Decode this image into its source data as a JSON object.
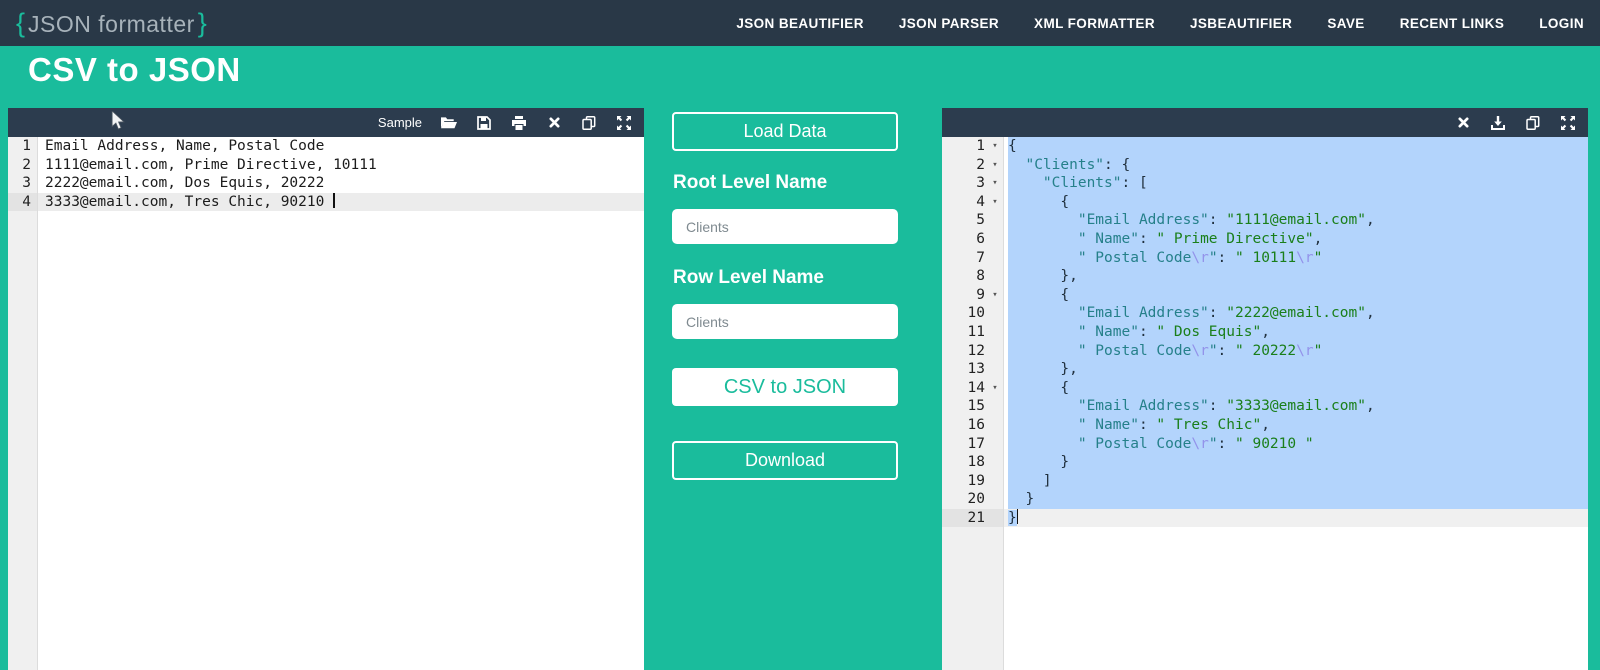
{
  "navbar": {
    "logo": {
      "open_brace": "{",
      "text": "JSON formatter",
      "close_brace": "}"
    },
    "items": [
      "JSON BEAUTIFIER",
      "JSON PARSER",
      "XML FORMATTER",
      "JSBEAUTIFIER",
      "SAVE",
      "RECENT LINKS",
      "LOGIN"
    ]
  },
  "page": {
    "title": "CSV to JSON"
  },
  "colors": {
    "teal_accent": "#1abc9c",
    "navbar_bg": "#293847",
    "toolbar_bg": "#2c3c4e",
    "selection_blue": "#b3d4fc",
    "json_key": "#25808a",
    "json_string": "#1a7f1a",
    "json_escape": "#9393ea"
  },
  "left_editor": {
    "toolbar": {
      "sample_label": "Sample",
      "icons": [
        "folder-open-icon",
        "save-icon",
        "print-icon",
        "clear-icon",
        "copy-icon",
        "fullscreen-icon"
      ]
    },
    "active_line": 4,
    "lines": [
      "Email Address, Name, Postal Code",
      "1111@email.com, Prime Directive, 10111",
      "2222@email.com, Dos Equis, 20222",
      "3333@email.com, Tres Chic, 90210 "
    ]
  },
  "controls": {
    "load_data_label": "Load Data",
    "root_level_label": "Root Level Name",
    "root_level_value": "Clients",
    "row_level_label": "Row Level Name",
    "row_level_value": "Clients",
    "convert_label": "CSV to JSON",
    "download_label": "Download"
  },
  "right_editor": {
    "toolbar": {
      "icons": [
        "clear-icon",
        "download-icon",
        "copy-icon",
        "fullscreen-icon"
      ]
    },
    "active_line": 21,
    "selected_from": 1,
    "selected_to": 20,
    "tail_selected": true,
    "fold_lines": [
      1,
      2,
      3,
      4,
      9,
      14
    ],
    "lines": [
      [
        [
          "{",
          "pln"
        ]
      ],
      [
        [
          "  ",
          "pln"
        ],
        [
          "\"Clients\"",
          "key"
        ],
        [
          ": {",
          "pln"
        ]
      ],
      [
        [
          "    ",
          "pln"
        ],
        [
          "\"Clients\"",
          "key"
        ],
        [
          ": [",
          "pln"
        ]
      ],
      [
        [
          "      {",
          "pln"
        ]
      ],
      [
        [
          "        ",
          "pln"
        ],
        [
          "\"Email Address\"",
          "key"
        ],
        [
          ": ",
          "pln"
        ],
        [
          "\"1111@email.com\"",
          "str"
        ],
        [
          ",",
          "pln"
        ]
      ],
      [
        [
          "        ",
          "pln"
        ],
        [
          "\" Name\"",
          "key"
        ],
        [
          ": ",
          "pln"
        ],
        [
          "\" Prime Directive\"",
          "str"
        ],
        [
          ",",
          "pln"
        ]
      ],
      [
        [
          "        ",
          "pln"
        ],
        [
          "\" Postal Code",
          "key"
        ],
        [
          "\\r",
          "esc"
        ],
        [
          "\"",
          "key"
        ],
        [
          ": ",
          "pln"
        ],
        [
          "\" 10111",
          "str"
        ],
        [
          "\\r",
          "esc"
        ],
        [
          "\"",
          "str"
        ]
      ],
      [
        [
          "      },",
          "pln"
        ]
      ],
      [
        [
          "      {",
          "pln"
        ]
      ],
      [
        [
          "        ",
          "pln"
        ],
        [
          "\"Email Address\"",
          "key"
        ],
        [
          ": ",
          "pln"
        ],
        [
          "\"2222@email.com\"",
          "str"
        ],
        [
          ",",
          "pln"
        ]
      ],
      [
        [
          "        ",
          "pln"
        ],
        [
          "\" Name\"",
          "key"
        ],
        [
          ": ",
          "pln"
        ],
        [
          "\" Dos Equis\"",
          "str"
        ],
        [
          ",",
          "pln"
        ]
      ],
      [
        [
          "        ",
          "pln"
        ],
        [
          "\" Postal Code",
          "key"
        ],
        [
          "\\r",
          "esc"
        ],
        [
          "\"",
          "key"
        ],
        [
          ": ",
          "pln"
        ],
        [
          "\" 20222",
          "str"
        ],
        [
          "\\r",
          "esc"
        ],
        [
          "\"",
          "str"
        ]
      ],
      [
        [
          "      },",
          "pln"
        ]
      ],
      [
        [
          "      {",
          "pln"
        ]
      ],
      [
        [
          "        ",
          "pln"
        ],
        [
          "\"Email Address\"",
          "key"
        ],
        [
          ": ",
          "pln"
        ],
        [
          "\"3333@email.com\"",
          "str"
        ],
        [
          ",",
          "pln"
        ]
      ],
      [
        [
          "        ",
          "pln"
        ],
        [
          "\" Name\"",
          "key"
        ],
        [
          ": ",
          "pln"
        ],
        [
          "\" Tres Chic\"",
          "str"
        ],
        [
          ",",
          "pln"
        ]
      ],
      [
        [
          "        ",
          "pln"
        ],
        [
          "\" Postal Code",
          "key"
        ],
        [
          "\\r",
          "esc"
        ],
        [
          "\"",
          "key"
        ],
        [
          ": ",
          "pln"
        ],
        [
          "\" 90210 \"",
          "str"
        ]
      ],
      [
        [
          "      }",
          "pln"
        ]
      ],
      [
        [
          "    ]",
          "pln"
        ]
      ],
      [
        [
          "  }",
          "pln"
        ]
      ],
      [
        [
          "}",
          "pln"
        ]
      ]
    ]
  }
}
